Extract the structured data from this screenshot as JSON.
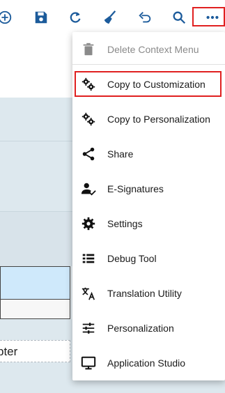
{
  "toolbar": {
    "icons": [
      "add-circle-icon",
      "save-icon",
      "refresh-icon",
      "clear-broom-icon",
      "undo-icon",
      "search-icon",
      "more-icon"
    ],
    "accent_color": "#1c5b9b"
  },
  "form": {
    "field_partial_text": "pter"
  },
  "menu": {
    "items": [
      {
        "label": "Delete Context Menu",
        "icon": "trash-icon",
        "disabled": true
      },
      {
        "label": "Copy to Customization",
        "icon": "gears-icon",
        "highlighted": true
      },
      {
        "label": "Copy to Personalization",
        "icon": "gears-icon"
      },
      {
        "label": "Share",
        "icon": "share-icon"
      },
      {
        "label": "E-Signatures",
        "icon": "user-check-icon"
      },
      {
        "label": "Settings",
        "icon": "gear-icon"
      },
      {
        "label": "Debug Tool",
        "icon": "list-icon"
      },
      {
        "label": "Translation Utility",
        "icon": "translate-icon"
      },
      {
        "label": "Personalization",
        "icon": "sliders-icon"
      },
      {
        "label": "Application Studio",
        "icon": "monitor-icon"
      }
    ],
    "highlight_color": "#e02020"
  }
}
